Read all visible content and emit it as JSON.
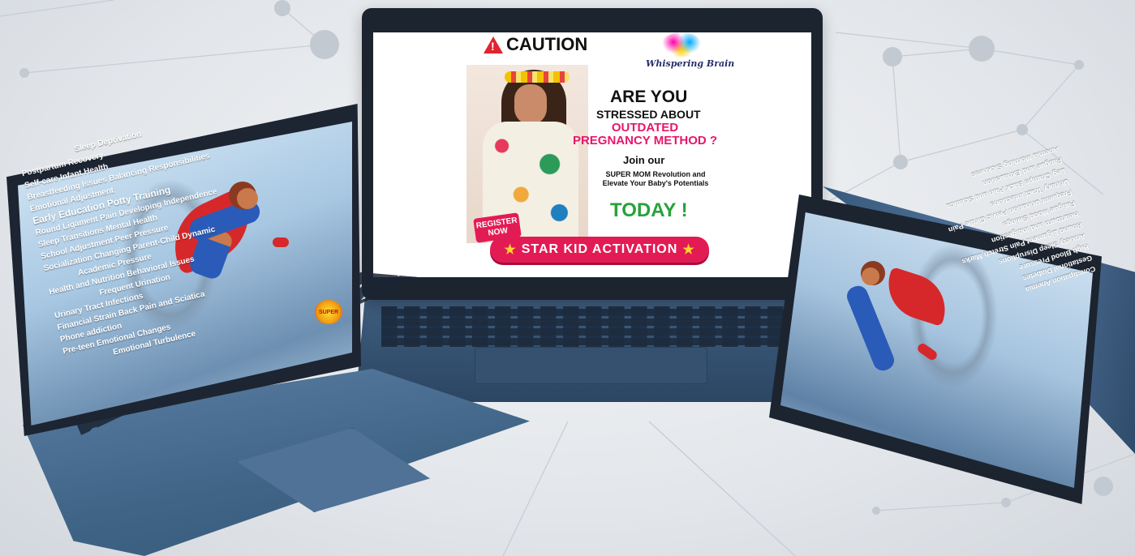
{
  "center_ad": {
    "caution": "CAUTION",
    "brand": "Whispering Brain",
    "headline1": "ARE YOU",
    "headline2": "STRESSED ABOUT",
    "headline3": "OUTDATED PREGNANCY METHOD ?",
    "join": "Join our",
    "super_mom": "SUPER MOM Revolution and Elevate Your Baby's Potentials",
    "today": "TODAY !",
    "register": "REGISTER NOW",
    "cta": "STAR KID ACTIVATION"
  },
  "left_screen": {
    "badge": "SUPER",
    "words": [
      "Sleep Deprivation",
      "Postpartum Recovery",
      "Self-care     Infant Health",
      "Breastfeeding Issues  Balancing Responsibilities",
      "Emotional Adjustment",
      "Early Education    Potty Training",
      "Round Ligament Pain   Developing Independence",
      "Sleep Transitions        Mental Health",
      "School Adjustment    Peer Pressure",
      "Socialization   Changing Parent-Child Dynamic",
      "Academic Pressure",
      "Health and Nutrition   Behavioral Issues",
      "Frequent Urination",
      "Urinary Tract Infections",
      "Financial Strain   Back Pain and Sciatica",
      "Phone addiction",
      "Pre-teen Emotional Changes",
      "Emotional Turbulence"
    ]
  },
  "right_screen": {
    "words": [
      "Constipation     Anemia",
      "Gestational Diabetes",
      "High Blood Pressure",
      "Anxiety      Sleep Disruptions",
      "Round Ligament Pain   Stretch Marks",
      "Heartburn and Indigestion",
      "Fatigue      Mood Swings",
      "Frequent Urination   Pelvic Girdle Pain",
      "Urinary Tract Infections",
      "Leg Cramps    Back Pain and Sciatica",
      "Fatigue and Exhaustion",
      "Anemia    Morning Sickness"
    ]
  }
}
